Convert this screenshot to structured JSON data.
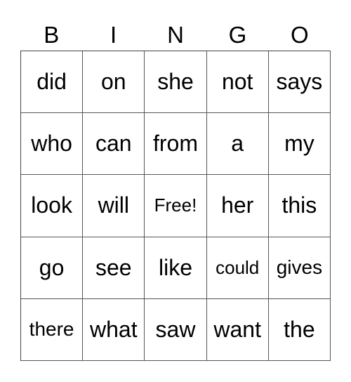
{
  "header": [
    "B",
    "I",
    "N",
    "G",
    "O"
  ],
  "cells": [
    [
      "did",
      "on",
      "she",
      "not",
      "says"
    ],
    [
      "who",
      "can",
      "from",
      "a",
      "my"
    ],
    [
      "look",
      "will",
      "Free!",
      "her",
      "this"
    ],
    [
      "go",
      "see",
      "like",
      "could",
      "gives"
    ],
    [
      "there",
      "what",
      "saw",
      "want",
      "the"
    ]
  ]
}
